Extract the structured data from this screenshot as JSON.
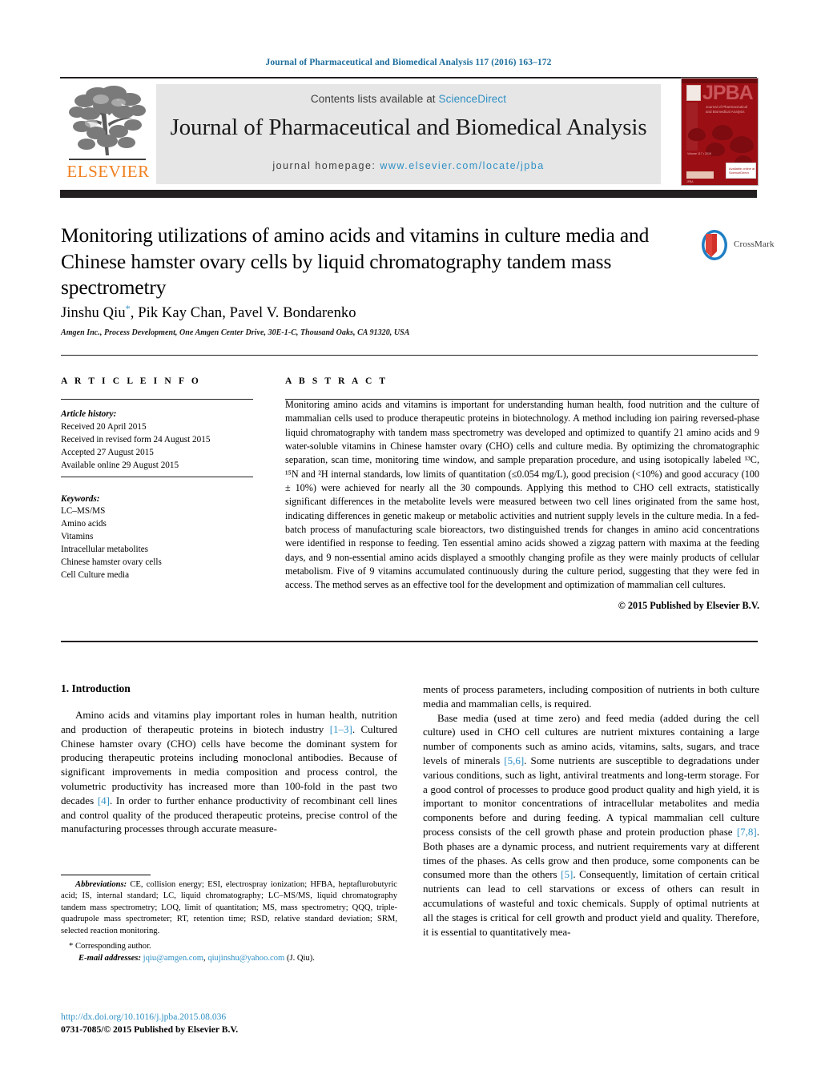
{
  "running_head": "Journal of Pharmaceutical and Biomedical Analysis 117 (2016) 163–172",
  "masthead": {
    "contents_prefix": "Contents lists available at ",
    "contents_link": "ScienceDirect",
    "journal_title": "Journal of Pharmaceutical and Biomedical Analysis",
    "homepage_prefix": "journal homepage: ",
    "homepage_url": "www.elsevier.com/locate/jpba",
    "publisher": "ELSEVIER",
    "cover": {
      "acronym": "JPBA",
      "subtitle": "Journal of Pharmaceutical and Biomedical Analysis",
      "meta": "Volume 117  •  2016",
      "badge": "Available online at ScienceDirect"
    }
  },
  "article": {
    "title": "Monitoring utilizations of amino acids and vitamins in culture media and Chinese hamster ovary cells by liquid chromatography tandem mass spectrometry",
    "authors": "Jinshu Qiu",
    "authors_rest": ", Pik Kay Chan, Pavel V. Bondarenko",
    "corresponding_marker": "*",
    "affiliation": "Amgen Inc., Process Development, One Amgen Center Drive, 30E-1-C, Thousand Oaks, CA 91320, USA",
    "crossmark_label": "CrossMark"
  },
  "article_info": {
    "heading": "A R T I C L E   I N F O",
    "history_label": "Article history:",
    "history": [
      "Received 20 April 2015",
      "Received in revised form 24 August 2015",
      "Accepted 27 August 2015",
      "Available online 29 August 2015"
    ],
    "keywords_label": "Keywords:",
    "keywords": [
      "LC–MS/MS",
      "Amino acids",
      "Vitamins",
      "Intracellular metabolites",
      "Chinese hamster ovary cells",
      "Cell Culture media"
    ]
  },
  "abstract": {
    "heading": "A B S T R A C T",
    "text": "Monitoring amino acids and vitamins is important for understanding human health, food nutrition and the culture of mammalian cells used to produce therapeutic proteins in biotechnology. A method including ion pairing reversed-phase liquid chromatography with tandem mass spectrometry was developed and optimized to quantify 21 amino acids and 9 water-soluble vitamins in Chinese hamster ovary (CHO) cells and culture media. By optimizing the chromatographic separation, scan time, monitoring time window, and sample preparation procedure, and using isotopically labeled ¹³C, ¹⁵N and ²H internal standards, low limits of quantitation (≤0.054 mg/L), good precision (<10%) and good accuracy (100 ± 10%) were achieved for nearly all the 30 compounds. Applying this method to CHO cell extracts, statistically significant differences in the metabolite levels were measured between two cell lines originated from the same host, indicating differences in genetic makeup or metabolic activities and nutrient supply levels in the culture media. In a fed-batch process of manufacturing scale bioreactors, two distinguished trends for changes in amino acid concentrations were identified in response to feeding. Ten essential amino acids showed a zigzag pattern with maxima at the feeding days, and 9 non-essential amino acids displayed a smoothly changing profile as they were mainly products of cellular metabolism. Five of 9 vitamins accumulated continuously during the culture period, suggesting that they were fed in access. The method serves as an effective tool for the development and optimization of mammalian cell cultures.",
    "copyright": "© 2015 Published by Elsevier B.V."
  },
  "body": {
    "section_number_title": "1.  Introduction",
    "left_para_1_a": "Amino acids and vitamins play important roles in human health, nutrition and production of therapeutic proteins in biotech industry ",
    "left_ref_1": "[1–3]",
    "left_para_1_b": ". Cultured Chinese hamster ovary (CHO) cells have become the dominant system for producing therapeutic proteins including monoclonal antibodies. Because of significant improvements in media composition and process control, the volumetric productivity has increased more than 100-fold in the past two decades ",
    "left_ref_2": "[4]",
    "left_para_1_c": ". In order to further enhance productivity of recombinant cell lines and control quality of the produced therapeutic proteins, precise control of the manufacturing processes through accurate measure-",
    "right_para_1": "ments of process parameters, including composition of nutrients in both culture media and mammalian cells, is required.",
    "right_para_2_a": "Base media (used at time zero) and feed media (added during the cell culture) used in CHO cell cultures are nutrient mixtures containing a large number of components such as amino acids, vitamins, salts, sugars, and trace levels of minerals ",
    "right_ref_1": "[5,6]",
    "right_para_2_b": ". Some nutrients are susceptible to degradations under various conditions, such as light, antiviral treatments and long-term storage. For a good control of processes to produce good product quality and high yield, it is important to monitor concentrations of intracellular metabolites and media components before and during feeding. A typical mammalian cell culture process consists of the cell growth phase and protein production phase ",
    "right_ref_2": "[7,8]",
    "right_para_2_c": ". Both phases are a dynamic process, and nutrient requirements vary at different times of the phases. As cells grow and then produce, some components can be consumed more than the others ",
    "right_ref_3": "[5]",
    "right_para_2_d": ". Consequently, limitation of certain critical nutrients can lead to cell starvations or excess of others can result in accumulations of wasteful and toxic chemicals. Supply of optimal nutrients at all the stages is critical for cell growth and product yield and quality. Therefore, it is essential to quantitatively mea-"
  },
  "footnotes": {
    "abbrev_label": "Abbreviations:",
    "abbrev_text": "  CE, collision energy; ESI, electrospray ionization; HFBA, heptaflurobutyric acid; IS, internal standard; LC, liquid chromatography; LC–MS/MS, liquid chromatography tandem mass spectrometry; LOQ, limit of quantitation; MS, mass spectrometry; QQQ, triple-quadrupole mass spectrometer; RT, retention time; RSD, relative standard deviation; SRM, selected reaction monitoring.",
    "corresponding": "*  Corresponding author.",
    "email_label": "E-mail addresses:",
    "email_1": "jqiu@amgen.com",
    "email_sep": ", ",
    "email_2": "qiujinshu@yahoo.com",
    "email_suffix": " (J. Qiu)."
  },
  "doi": {
    "url": "http://dx.doi.org/10.1016/j.jpba.2015.08.036",
    "issn": "0731-7085/© 2015 Published by Elsevier B.V."
  },
  "colors": {
    "link": "#2f90c4",
    "elsevier_orange": "#f08020",
    "band_dark": "#231f20",
    "band_grey": "#e6e6e6",
    "cover_red": "#9b0f14"
  }
}
